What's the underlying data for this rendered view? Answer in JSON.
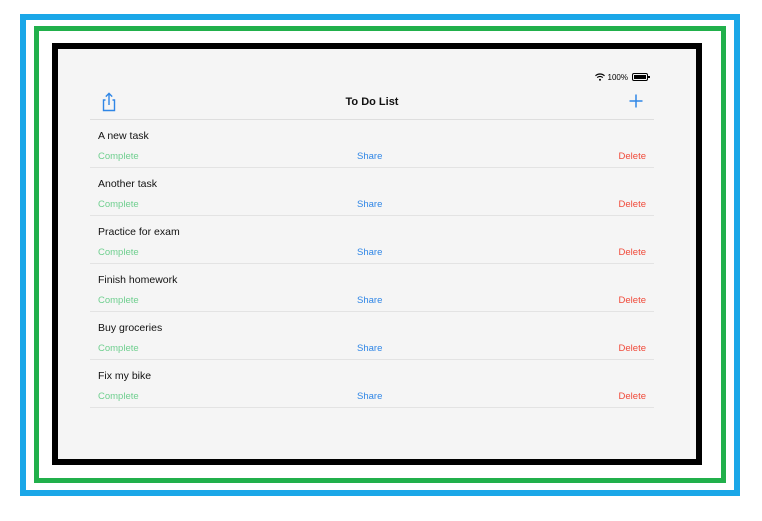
{
  "status_bar": {
    "battery": "100%"
  },
  "nav": {
    "title": "To Do List",
    "share_icon": "share-icon",
    "add_icon": "plus-icon"
  },
  "colors": {
    "accent": "#2f86e6",
    "complete": "#6fcf8f",
    "delete": "#f04a3a"
  },
  "tasks": [
    {
      "title": "A new task",
      "complete": "Complete",
      "share": "Share",
      "delete": "Delete"
    },
    {
      "title": "Another task",
      "complete": "Complete",
      "share": "Share",
      "delete": "Delete"
    },
    {
      "title": "Practice for exam",
      "complete": "Complete",
      "share": "Share",
      "delete": "Delete"
    },
    {
      "title": "Finish homework",
      "complete": "Complete",
      "share": "Share",
      "delete": "Delete"
    },
    {
      "title": "Buy groceries",
      "complete": "Complete",
      "share": "Share",
      "delete": "Delete"
    },
    {
      "title": "Fix my bike",
      "complete": "Complete",
      "share": "Share",
      "delete": "Delete"
    }
  ]
}
